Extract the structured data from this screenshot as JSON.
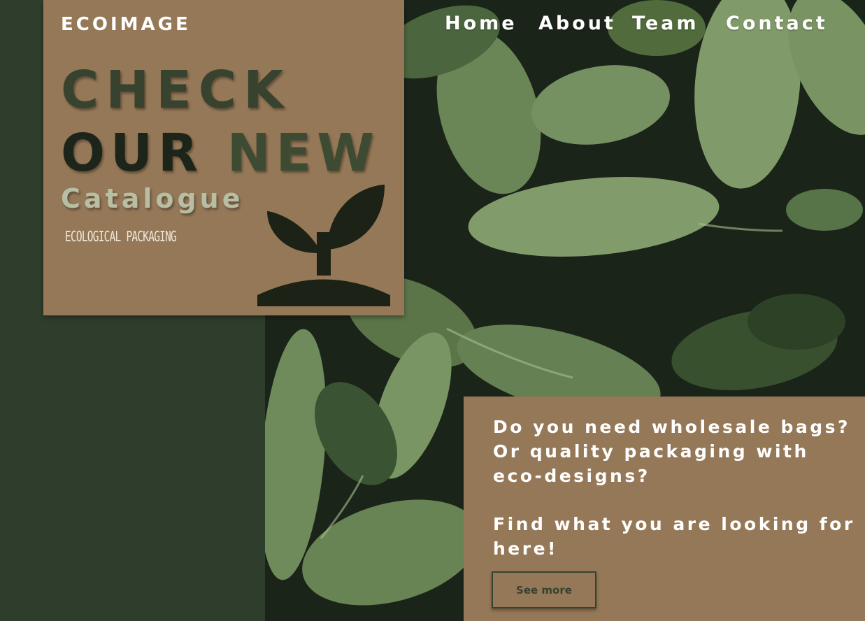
{
  "brand": {
    "name": "ECOIMAGE"
  },
  "nav": {
    "items": [
      "Home",
      "About",
      "Team",
      "Contact"
    ]
  },
  "hero": {
    "line1": "CHECK",
    "line2_dark": "OUR",
    "line2_green": "NEW",
    "catalogue": "Catalogue",
    "subtitle": "ECOLOGICAL PACKAGING",
    "icon": "sprout-icon"
  },
  "info": {
    "question": "Do you need wholesale bags? Or quality packaging with eco-designs?",
    "cta_text": "Find what you are looking for here!",
    "button_label": "See more"
  },
  "colors": {
    "background_dark_green": "#2f3d2c",
    "card_brown": "#957857",
    "headline_green": "#38432f",
    "headline_dark": "#1d2419",
    "catalogue_sage": "#b8bea3"
  }
}
